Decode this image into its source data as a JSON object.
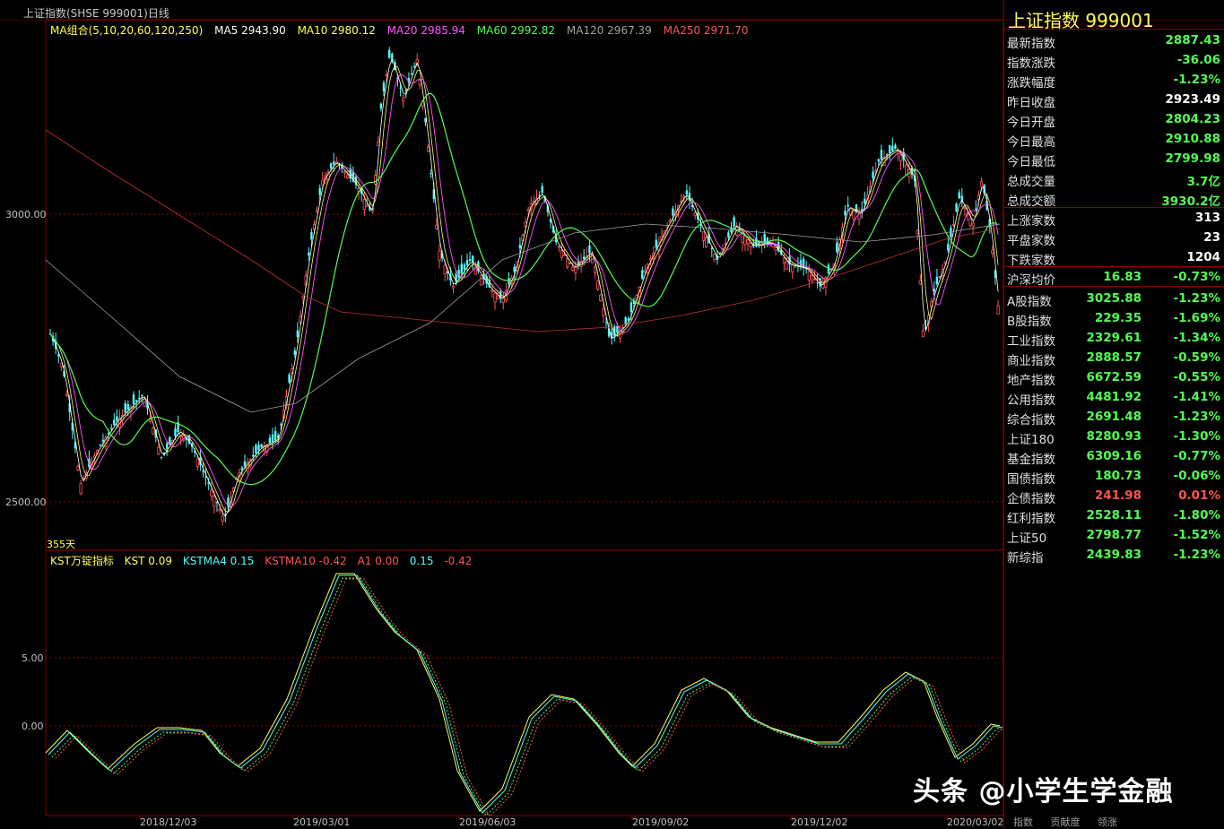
{
  "header": {
    "title": "上证指数(SHSE 999001)日线"
  },
  "ma_legend": {
    "group": "MA组合(5,10,20,60,120,250)",
    "ma5": "MA5 2943.90",
    "ma10": "MA10 2980.12",
    "ma20": "MA20 2985.94",
    "ma60": "MA60 2992.82",
    "ma120": "MA120 2967.39",
    "ma250": "MA250 2971.70"
  },
  "price_axis": {
    "label_high": "3000.00",
    "label_low": "2500.00"
  },
  "days_label": "355天",
  "kst_legend": {
    "name": "KST万锭指标",
    "kst": "KST 0.09",
    "kstma4": "KSTMA4 0.15",
    "kstma10": "KSTMA10 -0.42",
    "a1": "A1 0.00",
    "v1": "0.15",
    "v2": "-0.42"
  },
  "kst_axis": {
    "label_high": "5.00",
    "label_zero": "0.00"
  },
  "x_axis": [
    "2018/12/03",
    "2019/03/01",
    "2019/06/03",
    "2019/09/02",
    "2019/12/02",
    "2020/03/02"
  ],
  "sidebar": {
    "title": "上证指数  999001",
    "quote": [
      {
        "label": "最新指数",
        "value": "2887.43",
        "color": "#54fc54"
      },
      {
        "label": "指数涨跌",
        "value": "-36.06",
        "color": "#54fc54"
      },
      {
        "label": "涨跌幅度",
        "value": "-1.23%",
        "color": "#54fc54"
      },
      {
        "label": "昨日收盘",
        "value": "2923.49",
        "color": "#ffffff"
      },
      {
        "label": "今日开盘",
        "value": "2804.23",
        "color": "#54fc54"
      },
      {
        "label": "今日最高",
        "value": "2910.88",
        "color": "#54fc54"
      },
      {
        "label": "今日最低",
        "value": "2799.98",
        "color": "#54fc54"
      },
      {
        "label": "总成交量",
        "value": "3.7亿",
        "color": "#54fc54"
      },
      {
        "label": "总成交额",
        "value": "3930.2亿",
        "color": "#54fc54"
      }
    ],
    "breadth": [
      {
        "label": "上涨家数",
        "value": "313",
        "color": "#ffffff"
      },
      {
        "label": "平盘家数",
        "value": "23",
        "color": "#ffffff"
      },
      {
        "label": "下跌家数",
        "value": "1204",
        "color": "#ffffff"
      }
    ],
    "avg": {
      "label": "沪深均价",
      "value": "16.83",
      "pct": "-0.73%"
    },
    "indices": [
      {
        "label": "A股指数",
        "value": "3025.88",
        "pct": "-1.23%",
        "vcolor": "#54fc54",
        "pcolor": "#54fc54"
      },
      {
        "label": "B股指数",
        "value": "229.35",
        "pct": "-1.69%",
        "vcolor": "#54fc54",
        "pcolor": "#54fc54"
      },
      {
        "label": "工业指数",
        "value": "2329.61",
        "pct": "-1.34%",
        "vcolor": "#54fc54",
        "pcolor": "#54fc54"
      },
      {
        "label": "商业指数",
        "value": "2888.57",
        "pct": "-0.59%",
        "vcolor": "#54fc54",
        "pcolor": "#54fc54"
      },
      {
        "label": "地产指数",
        "value": "6672.59",
        "pct": "-0.55%",
        "vcolor": "#54fc54",
        "pcolor": "#54fc54"
      },
      {
        "label": "公用指数",
        "value": "4481.92",
        "pct": "-1.41%",
        "vcolor": "#54fc54",
        "pcolor": "#54fc54"
      },
      {
        "label": "综合指数",
        "value": "2691.48",
        "pct": "-1.23%",
        "vcolor": "#54fc54",
        "pcolor": "#54fc54"
      },
      {
        "label": "上证180",
        "value": "8280.93",
        "pct": "-1.30%",
        "vcolor": "#54fc54",
        "pcolor": "#54fc54"
      },
      {
        "label": "基金指数",
        "value": "6309.16",
        "pct": "-0.77%",
        "vcolor": "#54fc54",
        "pcolor": "#54fc54"
      },
      {
        "label": "国债指数",
        "value": "180.73",
        "pct": "-0.06%",
        "vcolor": "#54fc54",
        "pcolor": "#54fc54"
      },
      {
        "label": "企债指数",
        "value": "241.98",
        "pct": "0.01%",
        "vcolor": "#ff5454",
        "pcolor": "#ff5454"
      },
      {
        "label": "红利指数",
        "value": "2528.11",
        "pct": "-1.80%",
        "vcolor": "#54fc54",
        "pcolor": "#54fc54"
      },
      {
        "label": "上证50",
        "value": "2798.77",
        "pct": "-1.52%",
        "vcolor": "#54fc54",
        "pcolor": "#54fc54"
      },
      {
        "label": "新综指",
        "value": "2439.83",
        "pct": "-1.23%",
        "vcolor": "#54fc54",
        "pcolor": "#54fc54"
      }
    ],
    "tabs": [
      "指数",
      "贡献度",
      "领涨"
    ]
  },
  "watermark": "头条 @小学生学金融",
  "colors": {
    "up": "#ff5454",
    "down": "#54fcfc",
    "ma5": "#ffffff",
    "ma10": "#ffff54",
    "ma20": "#ff54ff",
    "ma60": "#54fc54",
    "ma120": "#a0a0a0",
    "ma250": "#c03030"
  }
}
